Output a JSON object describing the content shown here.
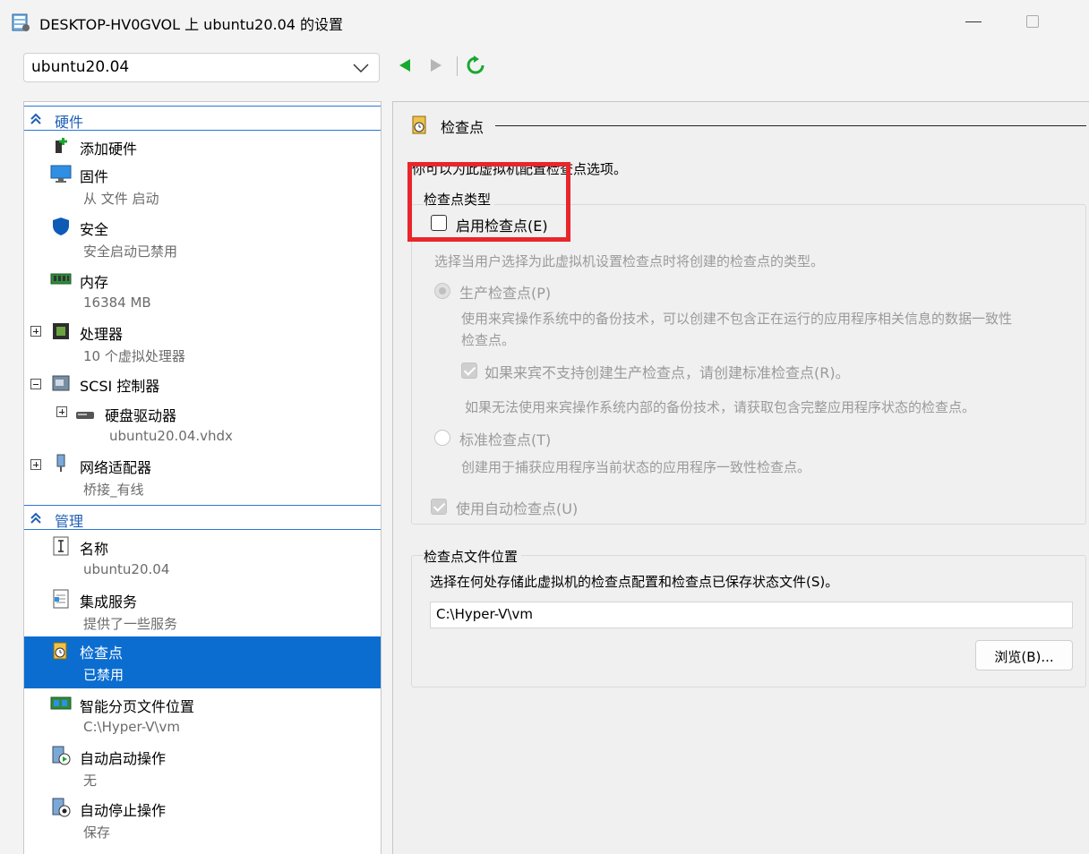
{
  "window": {
    "title": "DESKTOP-HV0GVOL 上 ubuntu20.04 的设置"
  },
  "toolbar": {
    "vm_selected": "ubuntu20.04"
  },
  "tree": {
    "hardware_header": "硬件",
    "management_header": "管理",
    "hardware_items": [
      {
        "name": "添加硬件",
        "sub": ""
      },
      {
        "name": "固件",
        "sub": "从 文件 启动"
      },
      {
        "name": "安全",
        "sub": "安全启动已禁用"
      },
      {
        "name": "内存",
        "sub": "16384 MB"
      },
      {
        "name": "处理器",
        "sub": "10 个虚拟处理器"
      },
      {
        "name": "SCSI 控制器",
        "sub": ""
      },
      {
        "name": "硬盘驱动器",
        "sub": "ubuntu20.04.vhdx"
      },
      {
        "name": "网络适配器",
        "sub": "桥接_有线"
      }
    ],
    "management_items": [
      {
        "name": "名称",
        "sub": "ubuntu20.04"
      },
      {
        "name": "集成服务",
        "sub": "提供了一些服务"
      },
      {
        "name": "检查点",
        "sub": "已禁用"
      },
      {
        "name": "智能分页文件位置",
        "sub": "C:\\Hyper-V\\vm"
      },
      {
        "name": "自动启动操作",
        "sub": "无"
      },
      {
        "name": "自动停止操作",
        "sub": "保存"
      }
    ]
  },
  "panel": {
    "title": "检查点",
    "description": "你可以为此虚拟机配置检查点选项。",
    "type_group_label": "检查点类型",
    "enable_checkpoints": "启用检查点(E)",
    "choose_type_text": "选择当用户选择为此虚拟机设置检查点时将创建的检查点的类型。",
    "production_label": "生产检查点(P)",
    "production_desc_1": "使用来宾操作系统中的备份技术，可以创建不包含正在运行的应用程序相关信息的数据一致性",
    "production_desc_2": "检查点。",
    "fallback_label": "如果来宾不支持创建生产检查点，请创建标准检查点(R)。",
    "fallback_desc": "如果无法使用来宾操作系统内部的备份技术，请获取包含完整应用程序状态的检查点。",
    "standard_label": "标准检查点(T)",
    "standard_desc": "创建用于捕获应用程序当前状态的应用程序一致性检查点。",
    "auto_checkpoint_label": "使用自动检查点(U)",
    "location_group_label": "检查点文件位置",
    "location_desc": "选择在何处存储此虚拟机的检查点配置和检查点已保存状态文件(S)。",
    "location_value": "C:\\Hyper-V\\vm",
    "browse_label": "浏览(B)..."
  },
  "colors": {
    "accent": "#0b6dd0",
    "highlight_box": "#e8262b",
    "header_text": "#1f5fb5"
  }
}
